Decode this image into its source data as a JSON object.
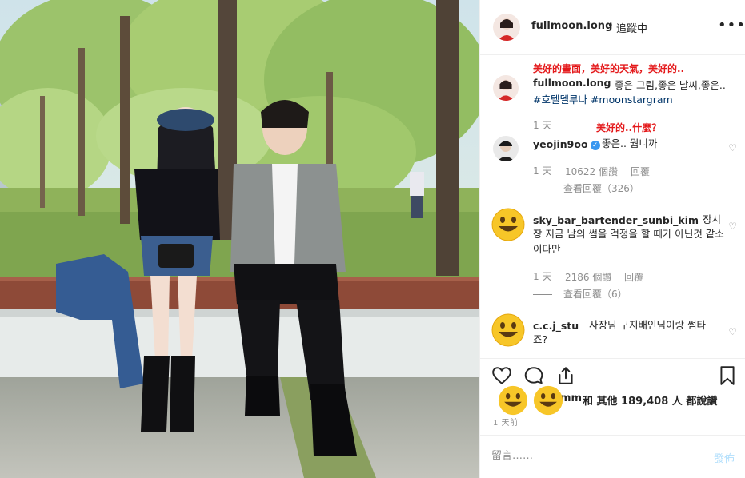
{
  "post": {
    "username": "fullmoon.long",
    "separator": "•",
    "follow_status": "追蹤中",
    "more_label": "•••",
    "annotation_caption": "美好的畫面，美好的天氣，美好的..",
    "caption_text": "좋은 그림,좋은 날씨,좋은..",
    "caption_tags": "#호텔델루나 #moonstargram",
    "caption_time": "1 天"
  },
  "comments": [
    {
      "annotation": "美好的..什麼？",
      "username": "yeojin9oo",
      "verified": true,
      "text": "좋은.. 뭡니까",
      "time": "1 天",
      "likes": "10622 個讚",
      "reply_label": "回覆",
      "view_replies": "查看回覆（326）",
      "avatar_icon": "portrait-photo"
    },
    {
      "username": "sky_bar_bartender_sunbi_kim",
      "text": "장 지금 남의 썸을 걱정을 할 때가 아닌것 같소이다만",
      "text_line1_tail": "장시",
      "time": "1 天",
      "likes": "2186 個讚",
      "reply_label": "回覆",
      "view_replies": "查看回覆（6）",
      "avatar_icon": "smiley-emoji"
    },
    {
      "username": "c.c.j_stu",
      "text": "사장님 구지배인님이랑 썸타",
      "text_line2": "죠?",
      "avatar_icon": "smiley-emoji"
    }
  ],
  "likes": {
    "partial_name": "s",
    "partial_name_tail": "mm",
    "text": "和 其他 189,408 人 都說讚"
  },
  "posted": "1 天前",
  "comment_box": {
    "placeholder": "留言……",
    "post_label": "發佈"
  },
  "icons": {
    "heart": "heart-icon",
    "comment": "comment-icon",
    "share": "share-icon",
    "save": "bookmark-icon",
    "like_small": "heart-outline-icon"
  },
  "colors": {
    "annotation_red": "#e4191b",
    "hashtag": "#003569",
    "verified": "#3897f0",
    "muted": "#8e8e8e",
    "post_button": "#b2dffc"
  }
}
